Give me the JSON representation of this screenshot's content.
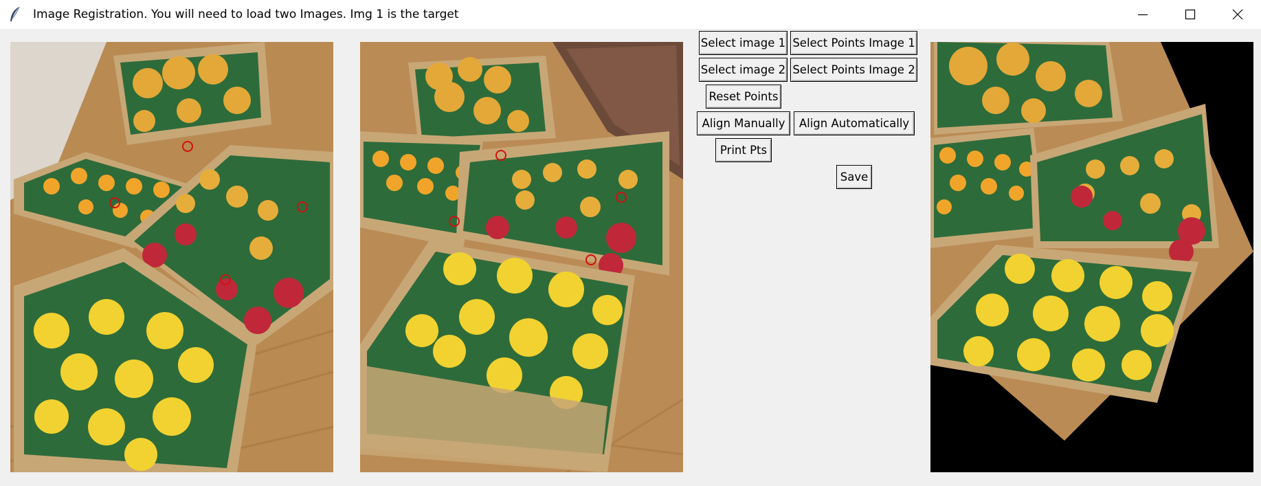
{
  "window": {
    "title": "Image Registration. You will need to load two Images. Img 1 is the target"
  },
  "buttons": {
    "select_image_1": "Select image 1",
    "select_points_image_1": "Select Points Image 1",
    "select_image_2": "Select image 2",
    "select_points_image_2": "Select Points Image 2",
    "reset_points": "Reset Points",
    "align_manually": "Align Manually",
    "align_automatically": "Align Automatically",
    "print_pts": "Print Pts",
    "save": "Save"
  },
  "icons": {
    "app": "feather-icon",
    "minimize": "minimize-icon",
    "maximize": "maximize-icon",
    "close": "close-icon"
  },
  "colors": {
    "point_marker": "#d01010",
    "button_face": "#f0f0f0",
    "window_bg": "#f0f0f0"
  }
}
